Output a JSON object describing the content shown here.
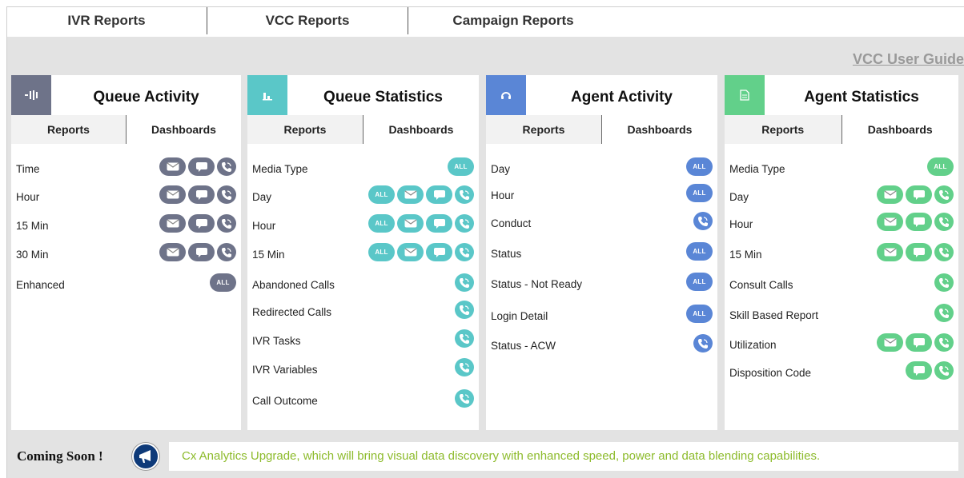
{
  "tabs": [
    {
      "label": "IVR Reports"
    },
    {
      "label": "VCC Reports"
    },
    {
      "label": "Campaign Reports"
    }
  ],
  "guide_link": "VCC User Guide",
  "icon_text_all": "ALL",
  "colors": {
    "accent_tab": "#f0984a",
    "queue_activity": "#6e7389",
    "queue_statistics": "#5ac7c8",
    "agent_activity": "#5a86d6",
    "agent_statistics": "#62d08a",
    "coming_soon_text": "#8dbb2c"
  },
  "panels": [
    {
      "title": "Queue Activity",
      "icon": "bars-icon",
      "color": "#6e7389",
      "reports_tab": "Reports",
      "dashboards_tab": "Dashboards",
      "rows": [
        {
          "label": "Time",
          "icons": [
            "email",
            "chat",
            "voice"
          ]
        },
        {
          "label": "Hour",
          "icons": [
            "email",
            "chat",
            "voice"
          ]
        },
        {
          "label": "15 Min",
          "icons": [
            "email",
            "chat",
            "voice"
          ]
        },
        {
          "label": "30 Min",
          "icons": [
            "email",
            "chat",
            "voice"
          ]
        },
        {
          "label": "Enhanced",
          "icons": [
            "all"
          ]
        }
      ]
    },
    {
      "title": "Queue Statistics",
      "icon": "bar-chart-icon",
      "color": "#5ac7c8",
      "reports_tab": "Reports",
      "dashboards_tab": "Dashboards",
      "rows": [
        {
          "label": "Media Type",
          "icons": [
            "all"
          ]
        },
        {
          "label": "Day",
          "icons": [
            "all",
            "email",
            "chat",
            "voice"
          ]
        },
        {
          "label": "Hour",
          "icons": [
            "all",
            "email",
            "chat",
            "voice"
          ]
        },
        {
          "label": "15 Min",
          "icons": [
            "all",
            "email",
            "chat",
            "voice"
          ]
        },
        {
          "label": "Abandoned Calls",
          "icons": [
            "voice"
          ]
        },
        {
          "label": "Redirected Calls",
          "icons": [
            "voice"
          ]
        },
        {
          "label": "IVR Tasks",
          "icons": [
            "voice"
          ]
        },
        {
          "label": "IVR Variables",
          "icons": [
            "voice"
          ]
        },
        {
          "label": "Call Outcome",
          "icons": [
            "voice"
          ]
        }
      ]
    },
    {
      "title": "Agent Activity",
      "icon": "headset-icon",
      "color": "#5a86d6",
      "reports_tab": "Reports",
      "dashboards_tab": "Dashboards",
      "rows": [
        {
          "label": "Day",
          "icons": [
            "all"
          ]
        },
        {
          "label": "Hour",
          "icons": [
            "all"
          ]
        },
        {
          "label": "Conduct",
          "icons": [
            "voice"
          ]
        },
        {
          "label": "Status",
          "icons": [
            "all"
          ]
        },
        {
          "label": "Status - Not Ready",
          "icons": [
            "all"
          ]
        },
        {
          "label": "Login Detail",
          "icons": [
            "all"
          ]
        },
        {
          "label": "Status - ACW",
          "icons": [
            "voice"
          ]
        }
      ]
    },
    {
      "title": "Agent Statistics",
      "icon": "document-icon",
      "color": "#62d08a",
      "reports_tab": "Reports",
      "dashboards_tab": "Dashboards",
      "rows": [
        {
          "label": "Media Type",
          "icons": [
            "all"
          ]
        },
        {
          "label": "Day",
          "icons": [
            "email",
            "chat",
            "voice"
          ]
        },
        {
          "label": "Hour",
          "icons": [
            "email",
            "chat",
            "voice"
          ]
        },
        {
          "label": "15 Min",
          "icons": [
            "email",
            "chat",
            "voice"
          ]
        },
        {
          "label": "Consult Calls",
          "icons": [
            "voice"
          ]
        },
        {
          "label": "Skill Based Report",
          "icons": [
            "voice"
          ]
        },
        {
          "label": "Utilization",
          "icons": [
            "email",
            "chat",
            "voice"
          ]
        },
        {
          "label": "Disposition Code",
          "icons": [
            "chat",
            "voice"
          ]
        }
      ]
    }
  ],
  "coming_soon": {
    "label": "Coming Soon !",
    "icon": "megaphone-icon",
    "text": "Cx Analytics Upgrade, which will bring visual data discovery with enhanced speed, power and data blending capabilities."
  }
}
